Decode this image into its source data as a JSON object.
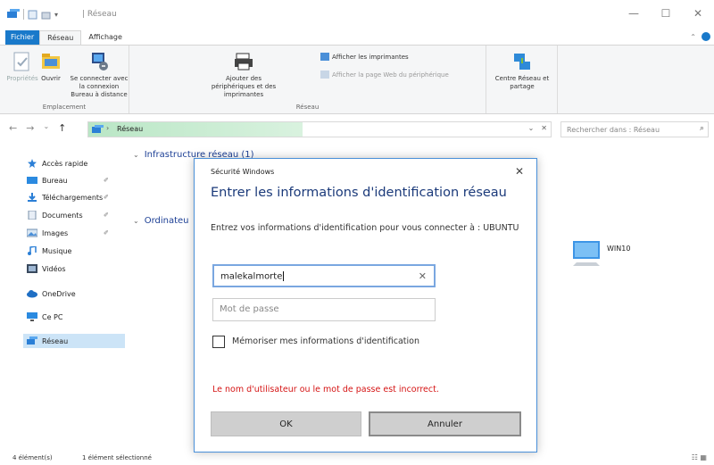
{
  "window": {
    "title": "| Réseau",
    "minimize": "—",
    "maximize": "☐",
    "close": "✕"
  },
  "ribbon_tabs": {
    "file": "Fichier",
    "network": "Réseau",
    "view": "Affichage"
  },
  "ribbon": {
    "properties": "Propriétés",
    "open": "Ouvrir",
    "remote_desktop": "Se connecter avec la connexion Bureau à distance",
    "location_group": "Emplacement",
    "add_devices": "Ajouter des périphériques et des imprimantes",
    "show_printers": "Afficher les imprimantes",
    "show_device_webpage": "Afficher la page Web du périphérique",
    "network_group": "Réseau",
    "network_center": "Centre Réseau et partage"
  },
  "address": {
    "path": "Réseau",
    "dropdown": "⌄",
    "clear": "✕",
    "search_placeholder": "Rechercher dans : Réseau",
    "search_icon": "⌕"
  },
  "nav_buttons": {
    "back": "←",
    "forward": "→",
    "recent": "⌄",
    "up": "↑"
  },
  "sidebar": {
    "items": [
      {
        "label": "Accès rapide",
        "icon": "star-icon"
      },
      {
        "label": "Bureau",
        "icon": "desktop-folder-icon",
        "pinned": true
      },
      {
        "label": "Téléchargements",
        "icon": "download-icon",
        "pinned": true
      },
      {
        "label": "Documents",
        "icon": "documents-icon",
        "pinned": true
      },
      {
        "label": "Images",
        "icon": "images-icon",
        "pinned": true
      },
      {
        "label": "Musique",
        "icon": "music-icon"
      },
      {
        "label": "Vidéos",
        "icon": "videos-icon"
      },
      {
        "label": "OneDrive",
        "icon": "cloud-icon"
      },
      {
        "label": "Ce PC",
        "icon": "computer-icon"
      },
      {
        "label": "Réseau",
        "icon": "network-icon",
        "selected": true
      }
    ],
    "pin_glyph": "✐"
  },
  "content": {
    "section_infra": "Infrastructure réseau (1)",
    "section_computers": "Ordinateu",
    "device_win10": "WIN10",
    "caret": "⌄",
    "caret_right": "›"
  },
  "status": {
    "items_count": "4 élément(s)",
    "selected": "1 élément sélectionné",
    "views": "☷ ▦"
  },
  "dialog": {
    "title": "Sécurité Windows",
    "close": "✕",
    "heading": "Entrer les informations d'identification réseau",
    "description": "Entrez vos informations d'identification pour vous connecter à : UBUNTU",
    "username_value": "malekalmorte",
    "clear_glyph": "✕",
    "password_placeholder": "Mot de passe",
    "remember_label": "Mémoriser mes informations d'identification",
    "remember_checked": false,
    "error": "Le nom d'utilisateur ou le mot de passe est incorrect.",
    "ok": "OK",
    "cancel": "Annuler"
  },
  "colors": {
    "accent": "#1979ca",
    "error": "#d51414",
    "heading": "#1b3a7a"
  }
}
